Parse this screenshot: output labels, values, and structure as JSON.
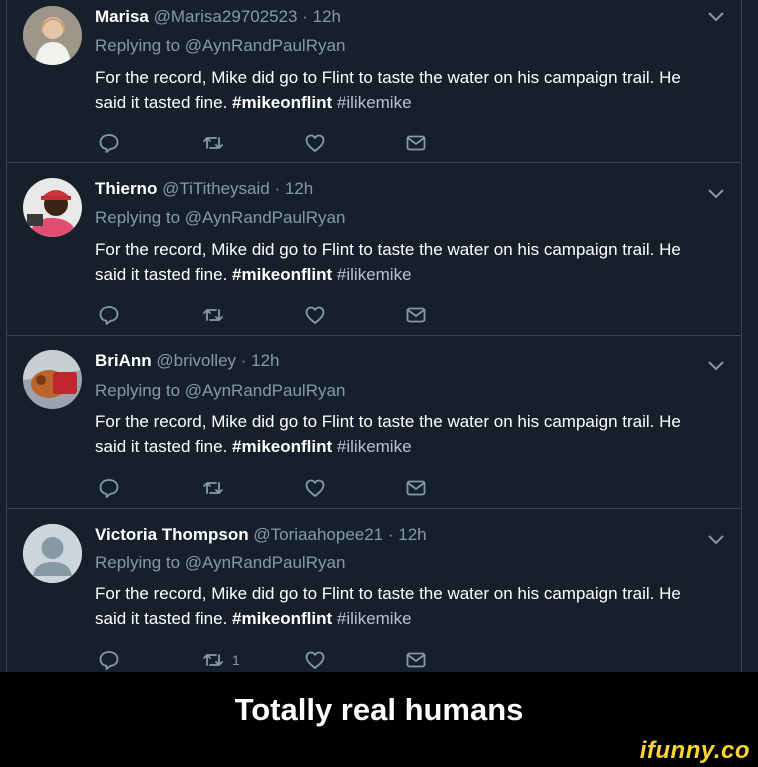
{
  "tweets": [
    {
      "name": "Marisa",
      "handle": "@Marisa29702523",
      "time": "· 12h",
      "replying": "Replying to",
      "mention": "@AynRandPaulRyan",
      "text": "For the record, Mike did go to Flint to taste the water on his campaign trail. He said it tasted fine.",
      "hashtag1": "#mikeonflint",
      "hashtag2": "#ilikemike",
      "retweet_count": ""
    },
    {
      "name": "Thierno",
      "handle": "@TiTitheysaid",
      "time": "· 12h",
      "replying": "Replying to",
      "mention": "@AynRandPaulRyan",
      "text": "For the record, Mike did go to Flint to taste the water on his campaign trail. He said it tasted fine.",
      "hashtag1": "#mikeonflint",
      "hashtag2": "#ilikemike",
      "retweet_count": ""
    },
    {
      "name": "BriAnn",
      "handle": "@brivolley",
      "time": "· 12h",
      "replying": "Replying to",
      "mention": "@AynRandPaulRyan",
      "text": "For the record, Mike did go to Flint to taste the water on his campaign trail. He said it tasted fine.",
      "hashtag1": "#mikeonflint",
      "hashtag2": "#ilikemike",
      "retweet_count": ""
    },
    {
      "name": "Victoria Thompson",
      "handle": "@Toriaahopee21",
      "time": "· 12h",
      "replying": "Replying to",
      "mention": "@AynRandPaulRyan",
      "text": "For the record, Mike did go to Flint to taste the water on his campaign trail. He said it tasted fine.",
      "hashtag1": "#mikeonflint",
      "hashtag2": "#ilikemike",
      "retweet_count": "1"
    }
  ],
  "caption": "Totally real humans",
  "watermark": "ifunny.co",
  "colors": {
    "background": "#15202b",
    "divider": "#38444d",
    "muted_text": "#8899a6",
    "watermark": "#fdd32f"
  },
  "icons": [
    "reply-icon",
    "retweet-icon",
    "like-icon",
    "message-icon",
    "chevron-down-icon"
  ]
}
